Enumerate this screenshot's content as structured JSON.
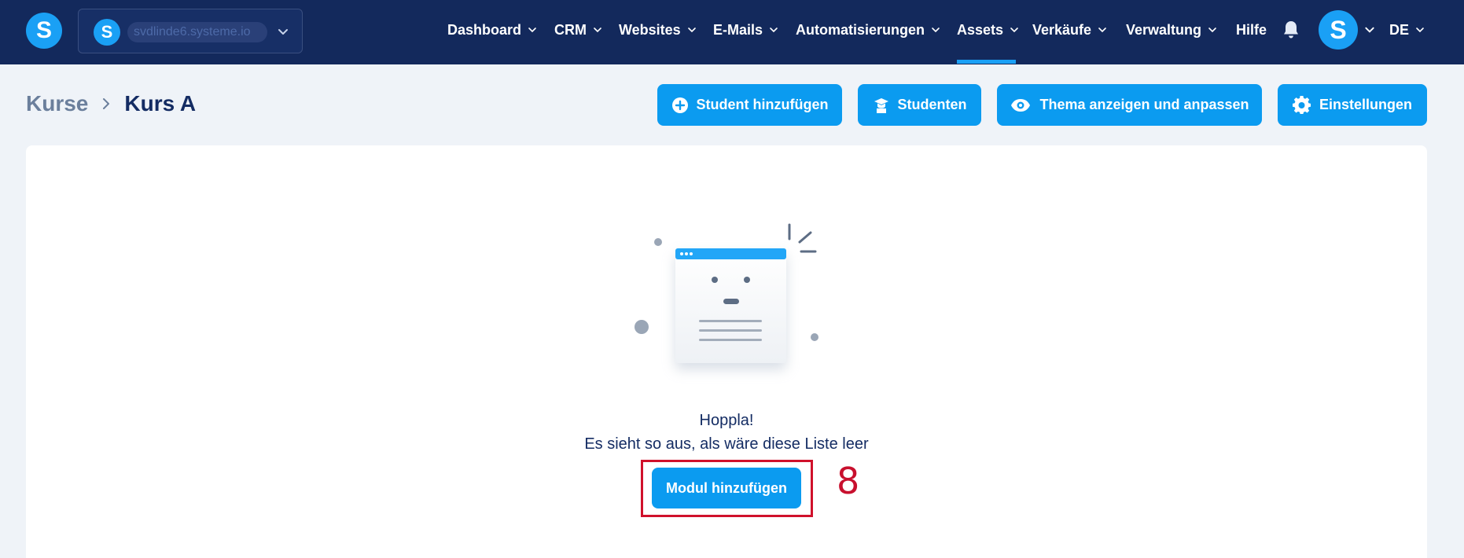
{
  "topbar": {
    "logo_letter": "S",
    "workspace": {
      "avatar_letter": "S",
      "name": "svdlinde6.systeme.io"
    },
    "nav": [
      {
        "label": "Dashboard",
        "has_dropdown": true
      },
      {
        "label": "CRM",
        "has_dropdown": true
      },
      {
        "label": "Websites",
        "has_dropdown": true
      },
      {
        "label": "E-Mails",
        "has_dropdown": true
      },
      {
        "label": "Automatisierungen",
        "has_dropdown": true
      },
      {
        "label": "Assets",
        "has_dropdown": true,
        "active": true
      },
      {
        "label": "Verkäufe",
        "has_dropdown": true
      },
      {
        "label": "Verwaltung",
        "has_dropdown": true
      },
      {
        "label": "Hilfe",
        "has_dropdown": false
      }
    ],
    "user_avatar_letter": "S",
    "language": "DE"
  },
  "breadcrumb": {
    "parent": "Kurse",
    "current": "Kurs A"
  },
  "actions": {
    "add_student": {
      "label": "Student hinzufügen",
      "icon": "plus-circle-icon"
    },
    "students": {
      "label": "Studenten",
      "icon": "graduate-icon"
    },
    "theme": {
      "label": "Thema anzeigen und anpassen",
      "icon": "eye-icon"
    },
    "settings": {
      "label": "Einstellungen",
      "icon": "gear-icon"
    }
  },
  "empty_state": {
    "title": "Hoppla!",
    "subtitle": "Es sieht so aus, als wäre diese Liste leer",
    "button_label": "Modul hinzufügen"
  },
  "annotation": {
    "step_number": "8"
  },
  "colors": {
    "topbar": "#13295c",
    "accent": "#0b9bf0",
    "page_bg": "#eff3f8",
    "highlight": "#d0112b"
  }
}
